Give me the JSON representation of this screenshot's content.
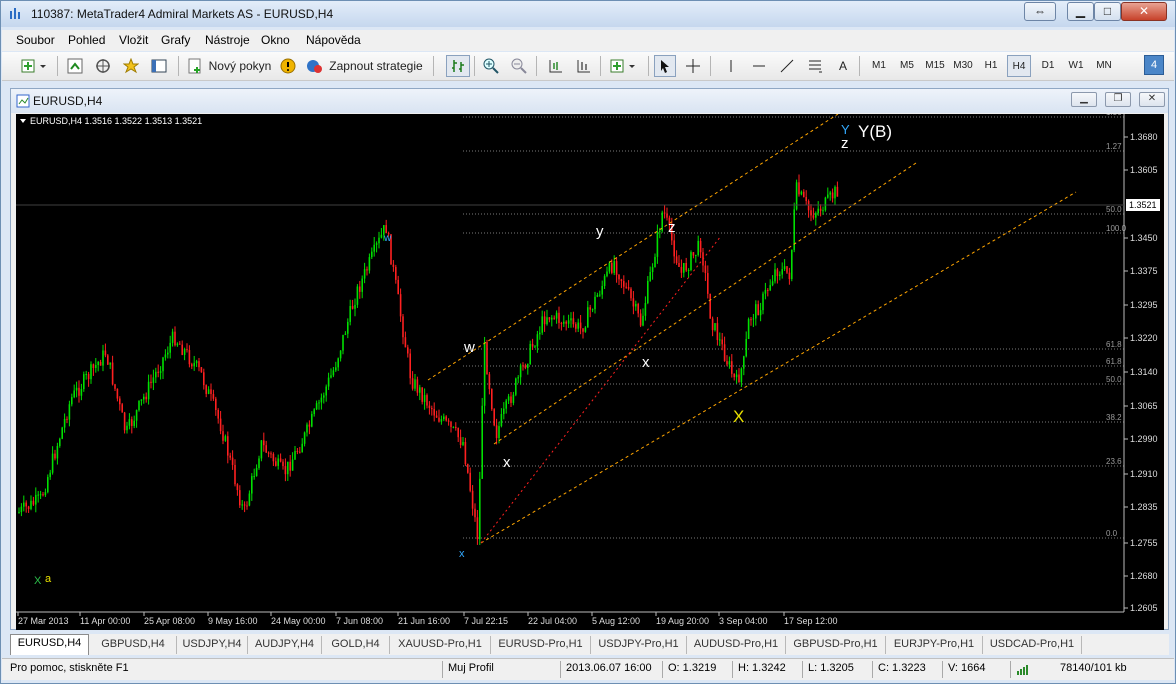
{
  "window": {
    "title": "110387: MetaTrader4 Admiral Markets AS - EURUSD,H4"
  },
  "menu": [
    "Soubor",
    "Pohled",
    "Vložit",
    "Grafy",
    "Nástroje",
    "Okno",
    "Nápověda"
  ],
  "toolbar": {
    "new_order": "Nový pokyn",
    "autotrading": "Zapnout strategie",
    "text_tool": "A",
    "timeframes": [
      "M1",
      "M5",
      "M15",
      "M30",
      "H1",
      "H4",
      "D1",
      "W1",
      "MN"
    ],
    "active_timeframe": "H4",
    "badge": "4"
  },
  "chart_window": {
    "title": "EURUSD,H4"
  },
  "chart": {
    "info": "EURUSD,H4  1.3516 1.3522 1.3513 1.3521",
    "current_price": "1.3521",
    "price_ticks": [
      "1.3680",
      "1.3605",
      "1.3521",
      "1.3450",
      "1.3375",
      "1.3295",
      "1.3220",
      "1.3140",
      "1.3065",
      "1.2990",
      "1.2910",
      "1.2835",
      "1.2755",
      "1.2680",
      "1.2605"
    ],
    "time_ticks": [
      "27 Mar 2013",
      "11 Apr 00:00",
      "25 Apr 08:00",
      "9 May 16:00",
      "24 May 00:00",
      "7 Jun 08:00",
      "21 Jun 16:00",
      "7 Jul 22:15",
      "22 Jul 04:00",
      "5 Aug 12:00",
      "19 Aug 20:00",
      "3 Sep 04:00",
      "17 Sep 12:00"
    ],
    "fib_levels": [
      "1.36",
      "1.27",
      "50.0",
      "100.0",
      "61.8",
      "61.8",
      "50.0",
      "38.2",
      "23.6",
      "0.0"
    ],
    "wave_labels": {
      "x_green": "X",
      "a_yellow": "a",
      "w_blue": "w",
      "x_blue": "x",
      "w_white": "w",
      "x_white_low": "x",
      "y_white": "y",
      "x_white_mid": "x",
      "z_white": "z",
      "x_yellow": "X",
      "y_blue": "Y",
      "z_top": "z",
      "yb": "Y(B)"
    },
    "colors": {
      "bull": "#00e000",
      "bear": "#ff2020",
      "channel": "#ffa500",
      "fib": "#7a7a7a",
      "grid": "#2a2a2a"
    }
  },
  "tabs": [
    "EURUSD,H4",
    "GBPUSD,H4",
    "USDJPY,H4",
    "AUDJPY,H4",
    "GOLD,H4",
    "XAUUSD-Pro,H1",
    "EURUSD-Pro,H1",
    "USDJPY-Pro,H1",
    "AUDUSD-Pro,H1",
    "GBPUSD-Pro,H1",
    "EURJPY-Pro,H1",
    "USDCAD-Pro,H1"
  ],
  "status": {
    "help": "Pro pomoc, stiskněte F1",
    "profile": "Muj Profil",
    "datetime": "2013.06.07 16:00",
    "open": "O: 1.3219",
    "high": "H: 1.3242",
    "low": "L: 1.3205",
    "close": "C: 1.3223",
    "volume": "V: 1664",
    "traffic": "78140/101 kb"
  }
}
